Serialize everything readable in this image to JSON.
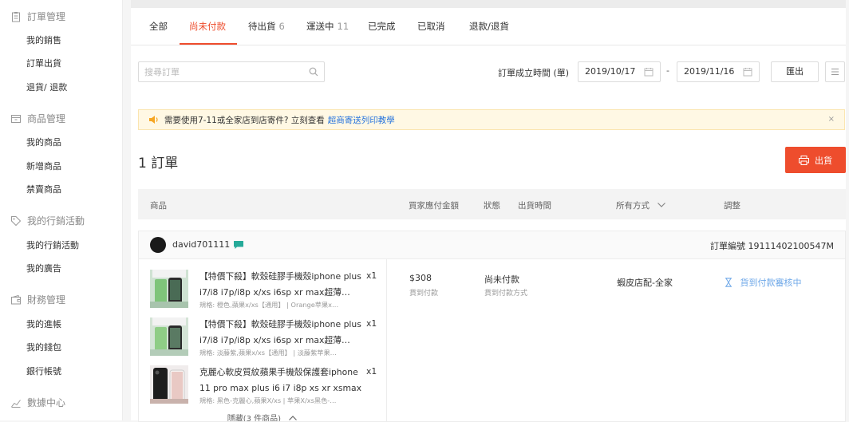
{
  "sidebar": {
    "sections": [
      {
        "title": "訂單管理",
        "icon": "clipboard-icon",
        "items": [
          "我的銷售",
          "訂單出貨",
          "退貨/ 退款"
        ]
      },
      {
        "title": "商品管理",
        "icon": "box-icon",
        "items": [
          "我的商品",
          "新增商品",
          "禁賣商品"
        ]
      },
      {
        "title": "我的行銷活動",
        "icon": "tag-icon",
        "items": [
          "我的行銷活動",
          "我的廣告"
        ]
      },
      {
        "title": "財務管理",
        "icon": "wallet-icon",
        "items": [
          "我的進帳",
          "我的錢包",
          "銀行帳號"
        ]
      },
      {
        "title": "數據中心",
        "icon": "chart-icon",
        "items": []
      }
    ]
  },
  "tabs": [
    {
      "label": "全部",
      "count": ""
    },
    {
      "label": "尚未付款",
      "count": ""
    },
    {
      "label": "待出貨",
      "count": "6"
    },
    {
      "label": "運送中",
      "count": "11"
    },
    {
      "label": "已完成",
      "count": ""
    },
    {
      "label": "已取消",
      "count": ""
    },
    {
      "label": "退款/退貨",
      "count": ""
    }
  ],
  "active_tab": 1,
  "filter": {
    "search_placeholder": "搜尋訂單",
    "date_label": "訂單成立時間 (單)",
    "date_from": "2019/10/17",
    "date_sep": "-",
    "date_to": "2019/11/16",
    "export_label": "匯出"
  },
  "banner": {
    "text": "需要使用7-11或全家店到店寄件? 立刻查看",
    "link": "超商寄送列印教學",
    "close": "×"
  },
  "order_count": "1 訂單",
  "ship_button": "出貨",
  "table_headers": {
    "product": "商品",
    "amount": "買家應付金額",
    "status": "狀態",
    "ship_time": "出貨時間",
    "method": "所有方式",
    "action": "調整"
  },
  "order": {
    "buyer": "david701111",
    "order_no": "訂單編號 19111402100547M",
    "items": [
      {
        "name": "【特價下殺】軟殼硅膠手機殼iphone plus i7/i8 i7p/i8p x/xs i6sp xr max超薄…",
        "spec": "規格: 橙色,蘋果x/xs【通用】 | Orange苹果x…",
        "qty": "x1"
      },
      {
        "name": "【特價下殺】軟殼硅膠手機殼iphone plus i7/i8 i7p/i8p x/xs i6sp xr max超薄…",
        "spec": "規格: 淡藤紫,蘋果x/xs【通用】 | 淡藤紫苹果…",
        "qty": "x1"
      },
      {
        "name": "克麗心軟皮質紋蘋果手機殼保護套iphone 11 pro max plus i6 i7 i8p xs xr xsmax",
        "spec": "規格: 黑色-克麗心,蘋果X/xs | 苹果X/xs黑色-…",
        "qty": "x1"
      }
    ],
    "collapse_label": "隱藏(3 件商品)",
    "amount": "$308",
    "amount_sub": "貨到付款",
    "status": "尚未付款",
    "status_sub": "貨到付款方式",
    "ship_method": "蝦皮店配-全家",
    "action": "貨到付款審核中"
  },
  "colors": {
    "accent": "#ee4d2d",
    "link": "#2673dd",
    "action": "#6fa8e8",
    "chat": "#26aa99",
    "banner_bg": "#fff8e4"
  }
}
